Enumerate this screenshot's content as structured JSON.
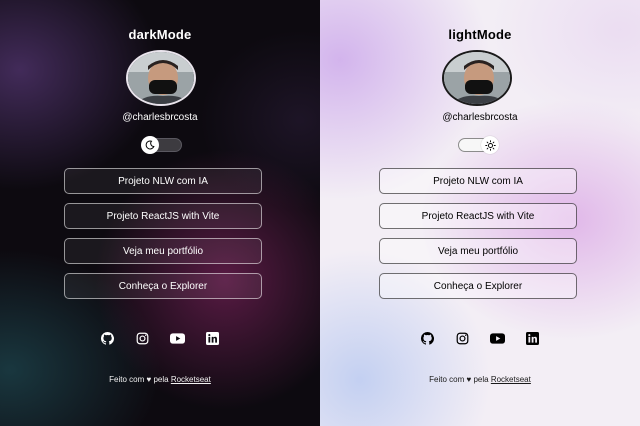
{
  "panels": {
    "dark": {
      "title": "darkMode",
      "handle": "@charlesbrcosta",
      "toggle_state": "moon",
      "links": [
        "Projeto NLW com IA",
        "Projeto ReactJS with Vite",
        "Veja meu portfólio",
        "Conheça o Explorer"
      ],
      "footer": {
        "prefix": "Feito com",
        "heart": "♥",
        "middle": "pela",
        "brand": "Rocketseat"
      }
    },
    "light": {
      "title": "lightMode",
      "handle": "@charlesbrcosta",
      "toggle_state": "sun",
      "links": [
        "Projeto NLW com IA",
        "Projeto ReactJS with Vite",
        "Veja meu portfólio",
        "Conheça o Explorer"
      ],
      "footer": {
        "prefix": "Feito com",
        "heart": "♥",
        "middle": "pela",
        "brand": "Rocketseat"
      }
    }
  },
  "social_icons": [
    "github-icon",
    "instagram-icon",
    "youtube-icon",
    "linkedin-icon"
  ],
  "colors": {
    "dark_bg": "#0d0a10",
    "light_bg": "#f3eef5",
    "dark_text": "#ffffff",
    "light_text": "#000000"
  }
}
